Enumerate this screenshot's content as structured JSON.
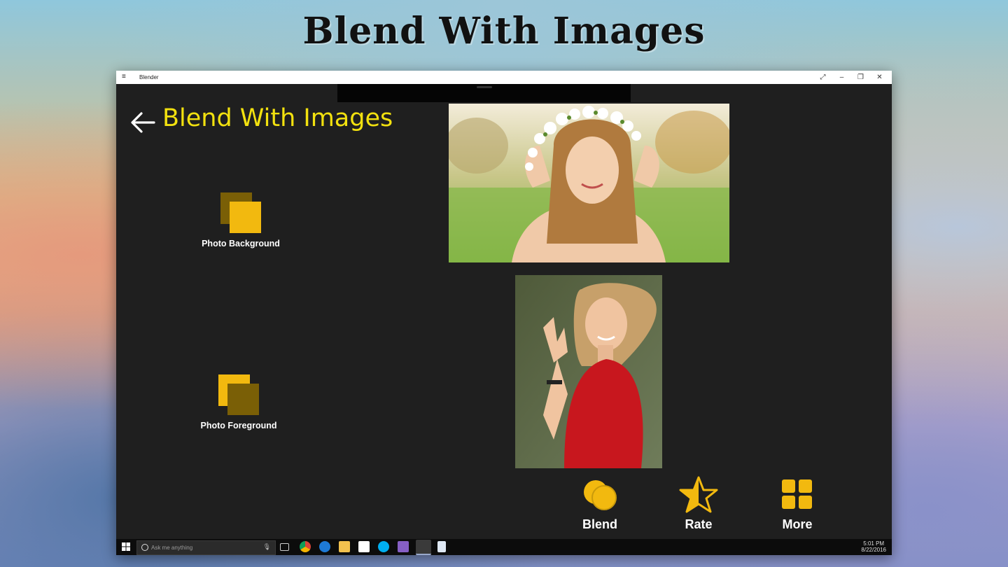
{
  "banner": {
    "title": "Blend With Images"
  },
  "window": {
    "app_name": "Blender",
    "menu_icon": "hamburger-menu-icon",
    "controls": {
      "fullscreen": "⤢",
      "minimize": "–",
      "restore": "❐",
      "close": "✕"
    }
  },
  "page": {
    "title": "Blend With Images",
    "back_icon": "back-arrow-icon"
  },
  "left_panel": {
    "background_tile": {
      "label": "Photo Background",
      "icon": "layers-icon"
    },
    "foreground_tile": {
      "label": "Photo Foreground",
      "icon": "layers-icon"
    }
  },
  "previews": {
    "background_image": "photo-woman-flower-crown",
    "foreground_image": "photo-woman-red-dress"
  },
  "actions": [
    {
      "label": "Blend",
      "icon": "blend-circles-icon"
    },
    {
      "label": "Rate",
      "icon": "star-icon"
    },
    {
      "label": "More",
      "icon": "grid-icon"
    }
  ],
  "taskbar": {
    "search_placeholder": "Ask me anything",
    "apps": [
      "task-view-icon",
      "chrome-icon",
      "edge-icon",
      "file-explorer-icon",
      "store-icon",
      "skype-icon",
      "visual-studio-icon",
      "blender-app-icon",
      "document-icon"
    ],
    "time": "5:01 PM",
    "date": "8/22/2016"
  },
  "colors": {
    "accent_yellow": "#f2e10f",
    "icon_gold": "#f2b90f",
    "icon_dark_gold": "#7a5f06",
    "window_bg": "#1f1f1f"
  }
}
